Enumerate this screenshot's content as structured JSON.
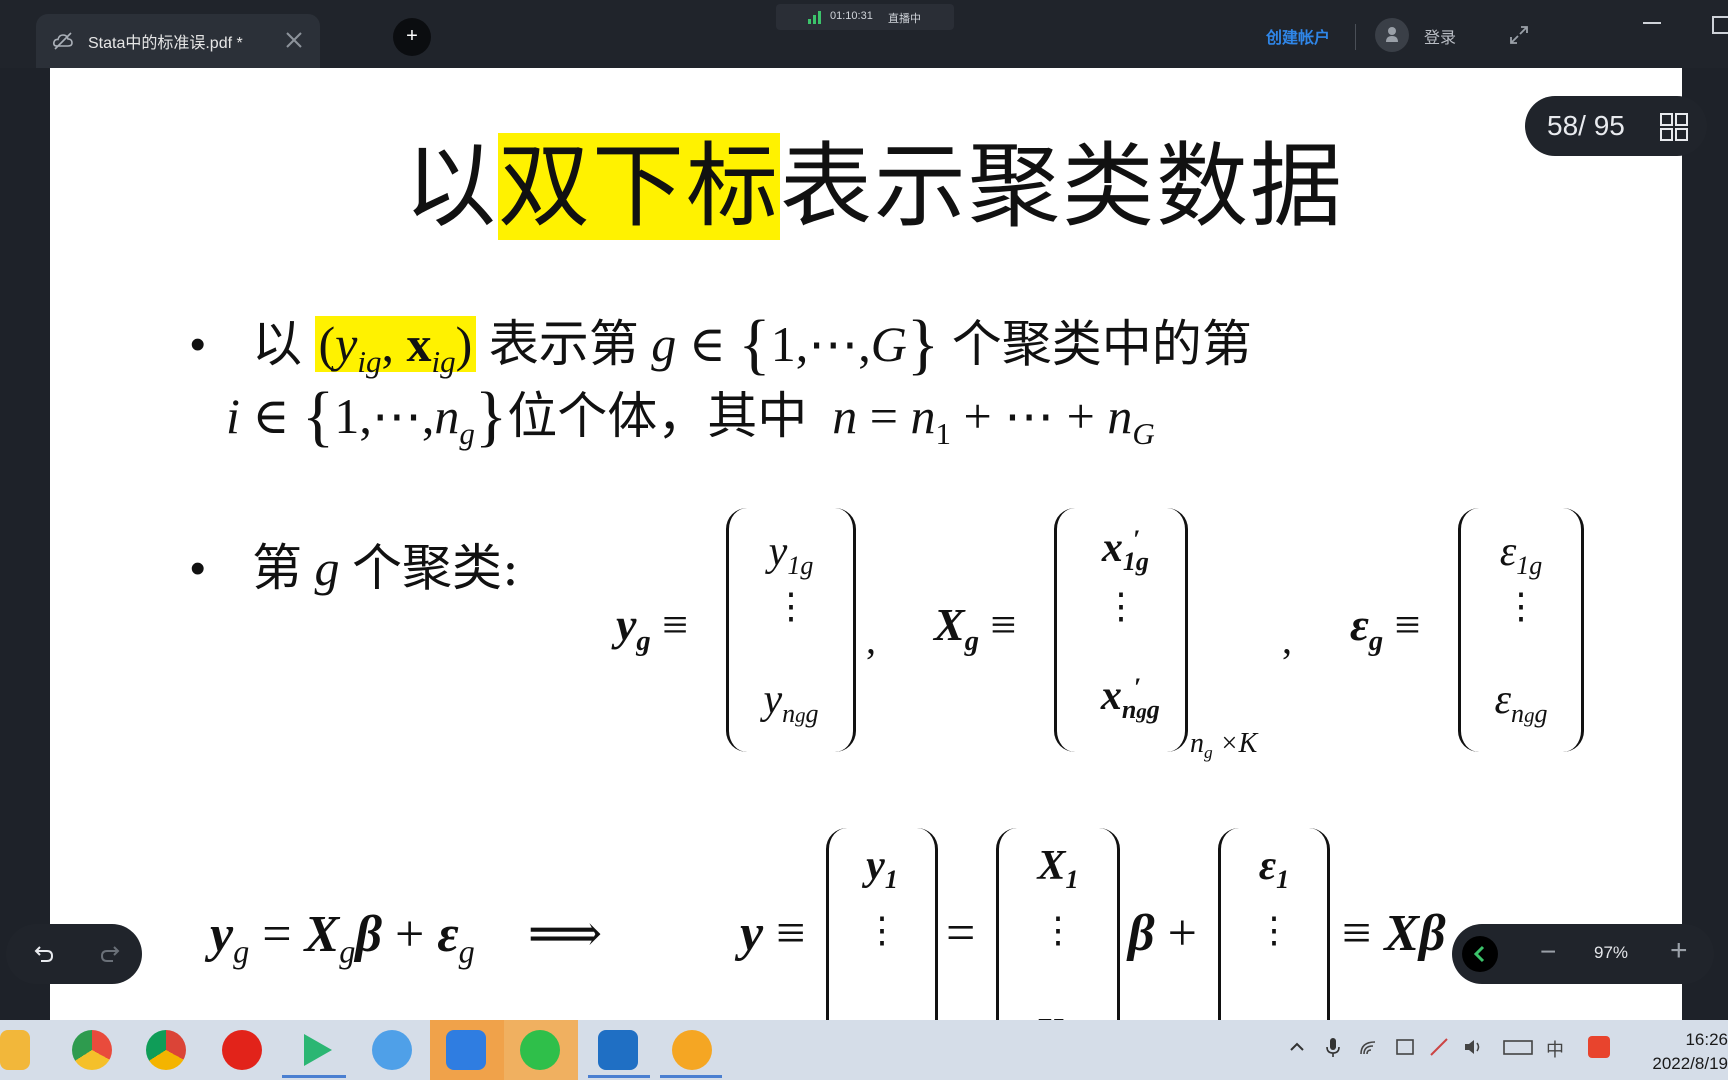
{
  "window": {
    "tab_title": "Stata中的标准误.pdf *",
    "add_tab": "+",
    "live_time": "01:10:31",
    "live_status": "直播中",
    "create_account": "创建帐户",
    "login": "登录"
  },
  "slide": {
    "title_pre": "以",
    "title_highlight": "双下标",
    "title_post": "表示聚类数据",
    "bullet1": {
      "t1": "以",
      "t2": "表示第",
      "t3": "个聚类中的第",
      "t4": "位个体，其中"
    },
    "bullet2": {
      "t1": "第",
      "t2": "个聚类:"
    }
  },
  "viewer": {
    "page_indicator": "58/ 95",
    "zoom": "97%",
    "zoom_minus": "−",
    "zoom_plus": "+"
  },
  "system": {
    "time": "16:26",
    "date": "2022/8/19",
    "ime": "中"
  },
  "colors": {
    "highlight": "#fff200",
    "accent_blue": "#2f86e8",
    "dark_ui": "#20242b"
  }
}
